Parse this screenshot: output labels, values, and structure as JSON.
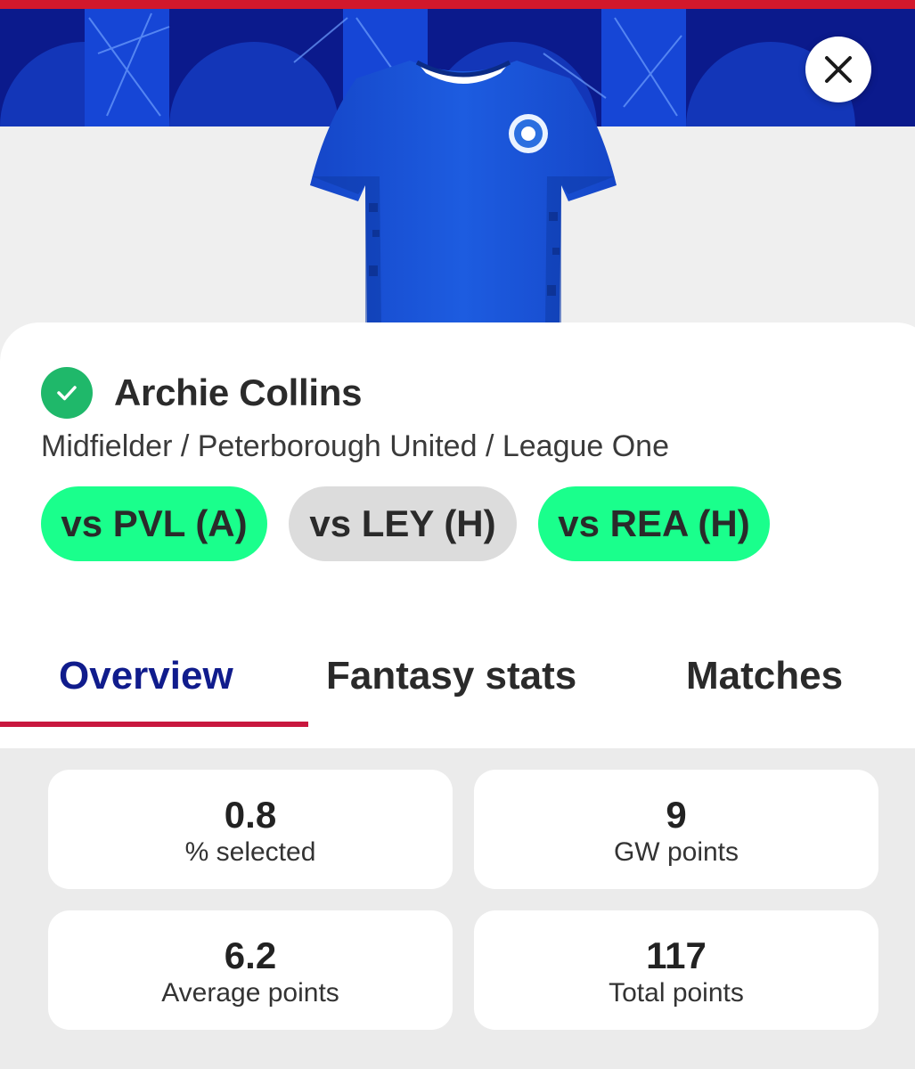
{
  "player": {
    "name": "Archie Collins",
    "meta": "Midfielder / Peterborough United / League One",
    "status_icon": "check-icon",
    "status_color": "#1fb86a"
  },
  "fixtures": [
    {
      "label": "vs PVL (A)",
      "color": "#1aff8c"
    },
    {
      "label": "vs LEY (H)",
      "color": "#dcdcdc"
    },
    {
      "label": "vs REA (H)",
      "color": "#1aff8c"
    }
  ],
  "tabs": [
    {
      "label": "Overview",
      "active": true
    },
    {
      "label": "Fantasy stats",
      "active": false
    },
    {
      "label": "Matches",
      "active": false
    }
  ],
  "stats": [
    {
      "value": "0.8",
      "label": "% selected"
    },
    {
      "value": "9",
      "label": "GW points"
    },
    {
      "value": "6.2",
      "label": "Average points"
    },
    {
      "value": "117",
      "label": "Total points"
    }
  ],
  "colors": {
    "banner": "#0b1a8c",
    "accent_underline": "#c8173e",
    "active_tab": "#101c8c",
    "kit": "#1a56d6"
  },
  "icons": {
    "close": "close-icon",
    "kit": "shirt-icon"
  }
}
